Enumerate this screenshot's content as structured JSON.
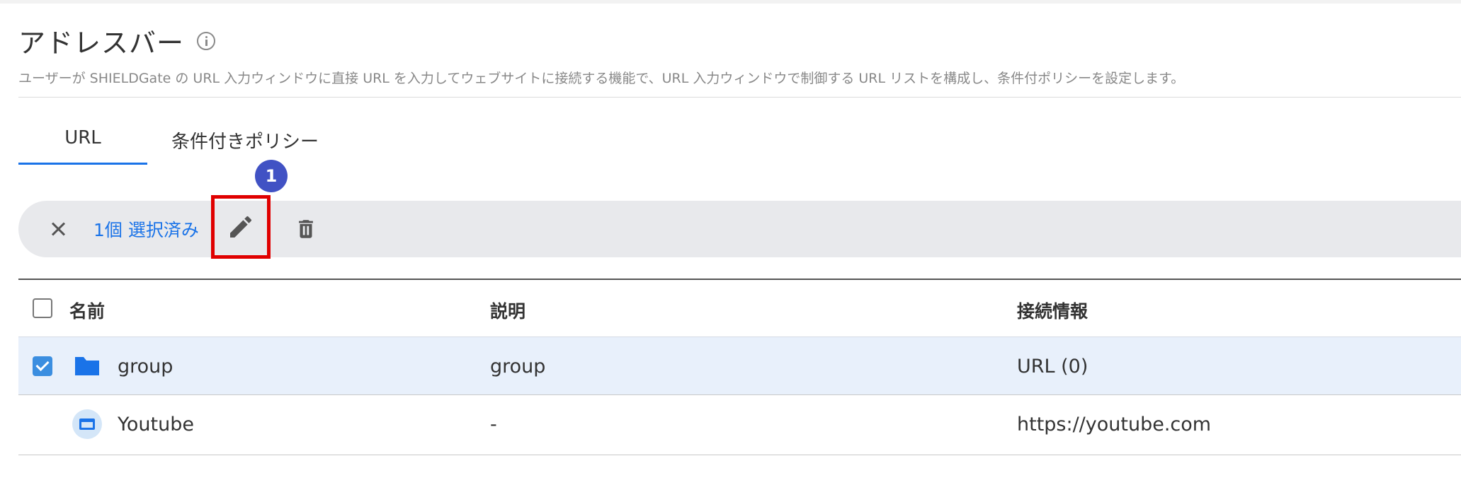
{
  "header": {
    "title": "アドレスバー",
    "description": "ユーザーが SHIELDGate の URL 入力ウィンドウに直接 URL を入力してウェブサイトに接続する機能で、URL 入力ウィンドウで制御する URL リストを構成し、条件付ポリシーを設定します。"
  },
  "tabs": [
    {
      "label": "URL",
      "active": true
    },
    {
      "label": "条件付きポリシー",
      "active": false
    }
  ],
  "step_badge": "1",
  "toolbar": {
    "selected_text": "1個 選択済み"
  },
  "table": {
    "columns": [
      "名前",
      "説明",
      "接続情報"
    ],
    "rows": [
      {
        "type": "folder",
        "checked": true,
        "name": "group",
        "description": "group",
        "connection": "URL (0)"
      },
      {
        "type": "url",
        "checked": false,
        "name": "Youtube",
        "description": "-",
        "connection": "https://youtube.com"
      }
    ]
  },
  "colors": {
    "accent": "#1a73e8",
    "highlight_box": "#e00000",
    "badge": "#4152c4",
    "selected_row": "#e8f0fb"
  }
}
